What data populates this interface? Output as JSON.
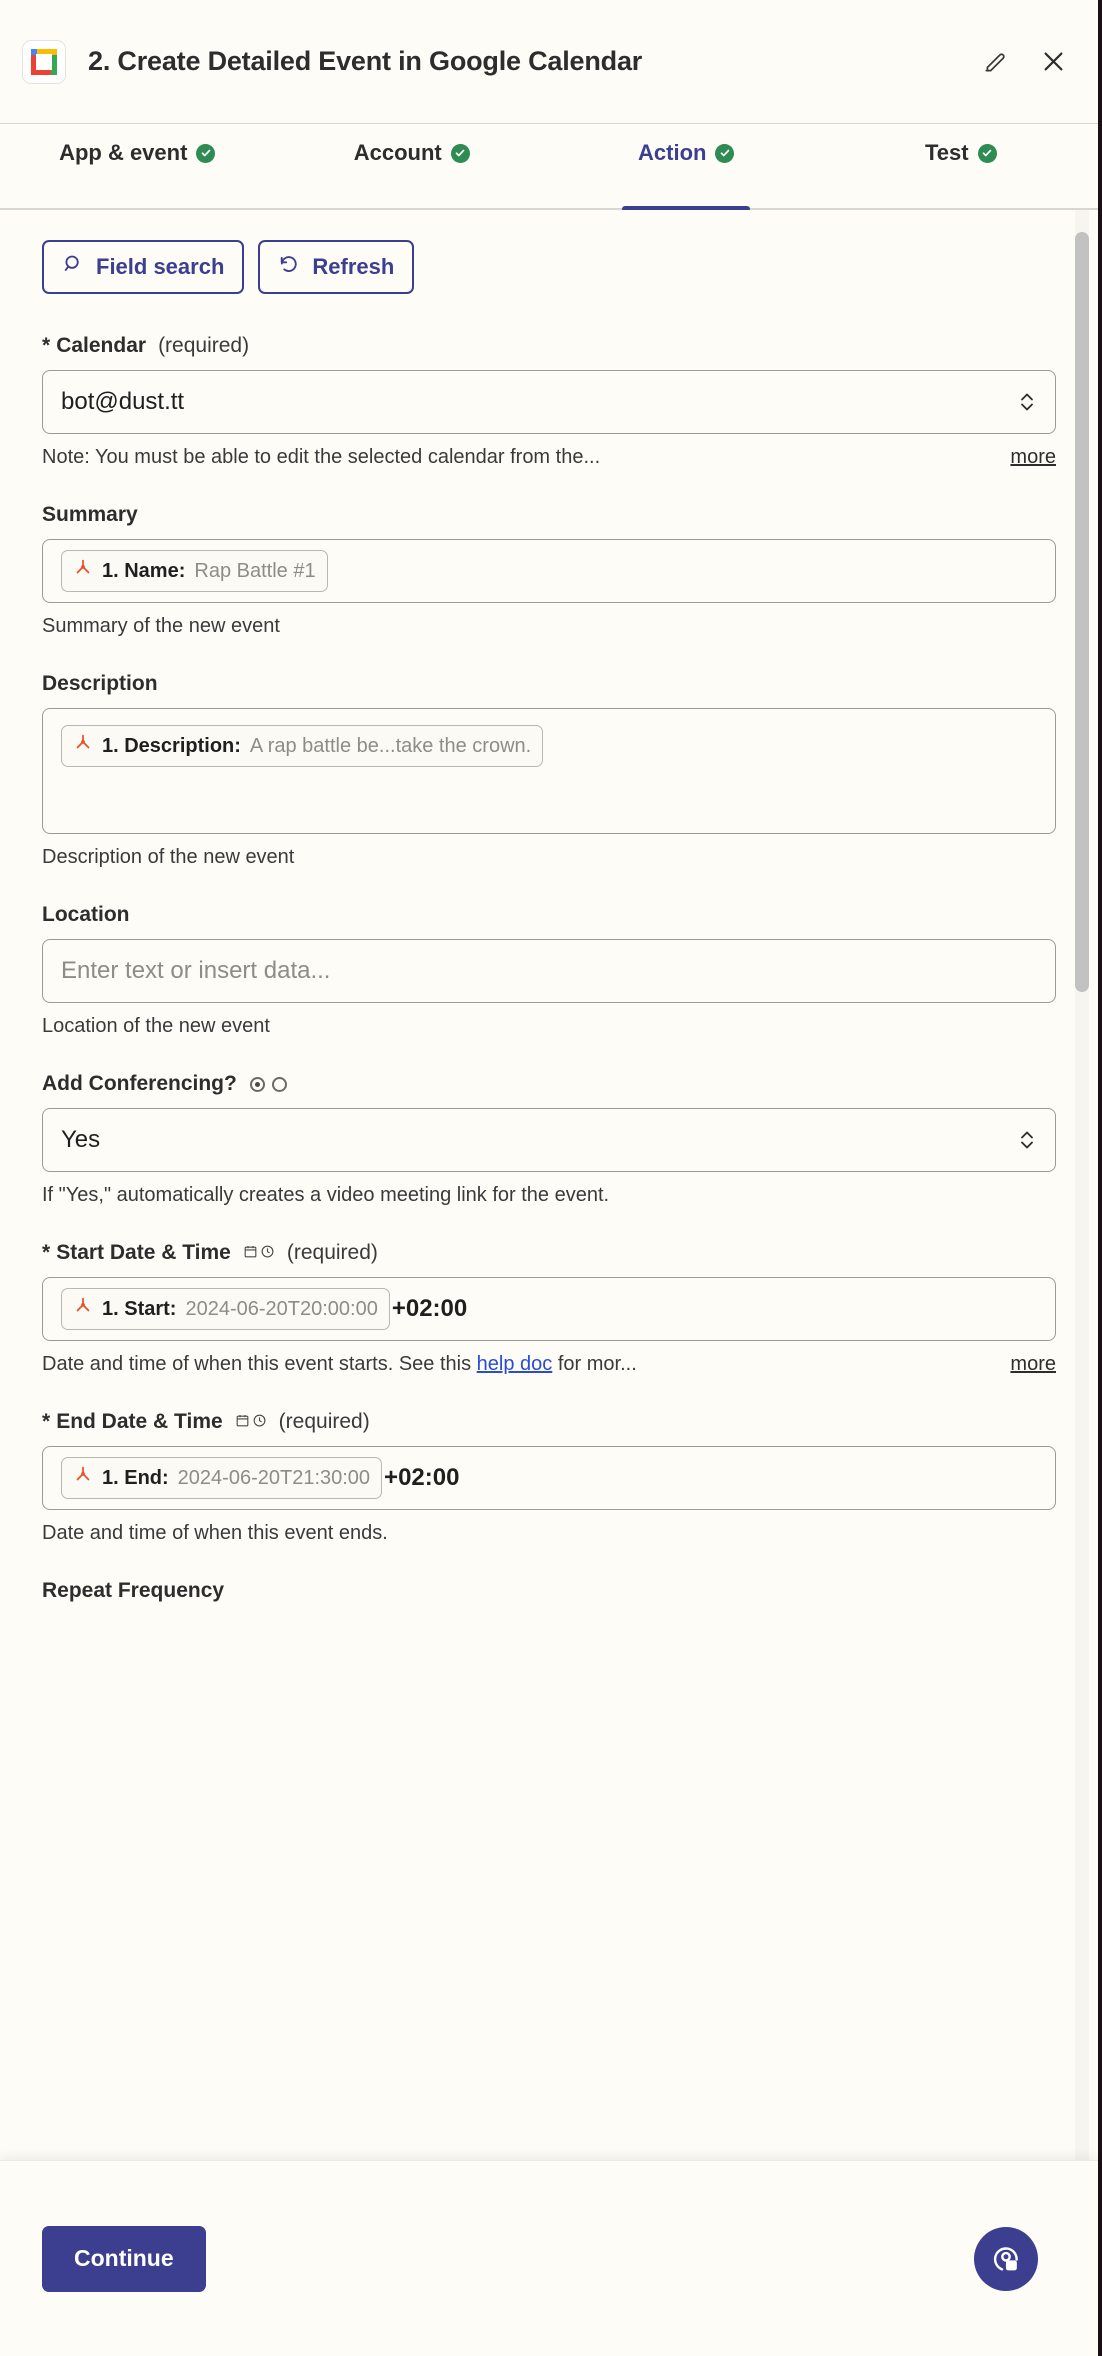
{
  "header": {
    "app_icon": "google-calendar-icon",
    "title": "2. Create Detailed Event in Google Calendar",
    "edit_icon": "pencil-icon",
    "close_icon": "close-icon"
  },
  "tabs": [
    {
      "label": "App & event",
      "status": "complete",
      "active": false
    },
    {
      "label": "Account",
      "status": "complete",
      "active": false
    },
    {
      "label": "Action",
      "status": "complete",
      "active": true
    },
    {
      "label": "Test",
      "status": "complete",
      "active": false
    }
  ],
  "toolbar": {
    "field_search_label": "Field search",
    "field_search_icon": "search-icon",
    "refresh_label": "Refresh",
    "refresh_icon": "refresh-icon"
  },
  "fields": {
    "calendar": {
      "label": "Calendar",
      "required_marker": "*",
      "required_text": "(required)",
      "value": "bot@dust.tt",
      "help": "Note: You must be able to edit the selected calendar from the...",
      "more_label": "more"
    },
    "summary": {
      "label": "Summary",
      "pill_key": "1. Name:",
      "pill_value": "Rap Battle #1",
      "help": "Summary of the new event"
    },
    "description": {
      "label": "Description",
      "pill_key": "1. Description:",
      "pill_value": "A rap battle be...take the crown.",
      "help": "Description of the new event"
    },
    "location": {
      "label": "Location",
      "placeholder": "Enter text or insert data...",
      "value": "",
      "help": "Location of the new event"
    },
    "conferencing": {
      "label": "Add Conferencing?",
      "value": "Yes",
      "help": "If \"Yes,\" automatically creates a video meeting link for the event.",
      "radio_selected_index": 0
    },
    "start": {
      "label": "Start Date & Time",
      "required_marker": "*",
      "required_text": "(required)",
      "pill_key": "1. Start:",
      "pill_value": "2024-06-20T20:00:00",
      "timezone": "+02:00",
      "help_before": "Date and time of when this event starts. See this ",
      "help_link": "help doc",
      "help_after": " for mor...",
      "more_label": "more"
    },
    "end": {
      "label": "End Date & Time",
      "required_marker": "*",
      "required_text": "(required)",
      "pill_key": "1. End:",
      "pill_value": "2024-06-20T21:30:00",
      "timezone": "+02:00",
      "help": "Date and time of when this event ends."
    },
    "repeat": {
      "label": "Repeat Frequency"
    }
  },
  "footer": {
    "continue_label": "Continue",
    "help_fab_icon": "support-chat-icon"
  },
  "colors": {
    "accent": "#3c3f8f",
    "success": "#2e8b52",
    "link": "#2b4bd4",
    "background": "#fdfcf7",
    "pill_logo": "#ee4f27"
  }
}
